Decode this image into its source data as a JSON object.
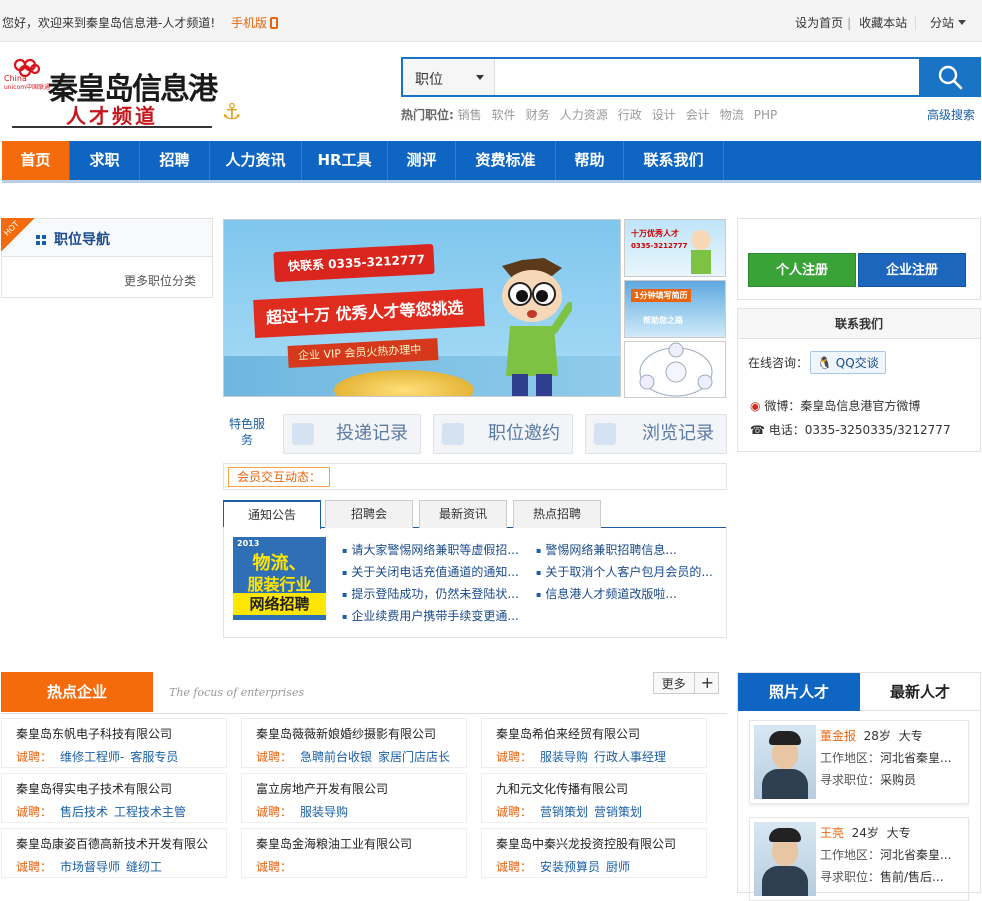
{
  "topbar": {
    "welcome": "您好，欢迎来到秦皇岛信息港-人才频道!",
    "mobile": "手机版",
    "set_home": "设为首页",
    "bookmark": "收藏本站",
    "substation": "分站"
  },
  "logo": {
    "text": "秦皇岛信息港",
    "sub": "人才频道",
    "unicom": "China unicom中国联通"
  },
  "search": {
    "category": "职位",
    "placeholder": "",
    "hot_label": "热门职位:",
    "hot": [
      "销售",
      "软件",
      "财务",
      "人力资源",
      "行政",
      "设计",
      "会计",
      "物流",
      "PHP"
    ],
    "advanced": "高级搜索"
  },
  "nav": [
    "首页",
    "求职",
    "招聘",
    "人力资讯",
    "HR工具",
    "测评",
    "资费标准",
    "帮助",
    "联系我们"
  ],
  "job_nav": {
    "hot": "HOT",
    "title": "职位导航",
    "more": "更多职位分类"
  },
  "banner": {
    "phone": "快联系 0335-3212777",
    "slogan": "超过十万 优秀人才等您挑选",
    "vip": "企业 VIP 会员火热办理中"
  },
  "services": {
    "label": "特色服务",
    "items": [
      "投递记录",
      "职位邀约",
      "浏览记录"
    ]
  },
  "dynamic": {
    "label": "会员交互动态："
  },
  "tabs": [
    "通知公告",
    "招聘会",
    "最新资讯",
    "热点招聘"
  ],
  "notice": {
    "image_text": [
      "2013",
      "物流、",
      "服装行业",
      "网络招聘"
    ],
    "left": [
      "请大家警惕网络兼职等虚假招...",
      "关于关闭电话充值通道的通知...",
      "提示登陆成功，仍然未登陆状...",
      "企业续费用户携带手续变更通..."
    ],
    "right": [
      "警惕网络兼职招聘信息...",
      "关于取消个人客户包月会员的...",
      "信息港人才频道改版啦..."
    ]
  },
  "register": {
    "personal": "个人注册",
    "company": "企业注册"
  },
  "contact": {
    "title": "联系我们",
    "online": "在线咨询：",
    "qq": "QQ交谈",
    "weibo": "微博：秦皇岛信息港官方微博",
    "phone": "电话：0335-3250335/3212777"
  },
  "hot_enterprises": {
    "title": "热点企业",
    "subtitle": "The focus of enterprises",
    "more": "更多",
    "label": "诚聘：",
    "items": [
      {
        "name": "秦皇岛东帆电子科技有限公司",
        "jobs": [
          "维修工程师-",
          "客服专员"
        ]
      },
      {
        "name": "秦皇岛薇薇新娘婚纱摄影有限公司",
        "jobs": [
          "急聘前台收银",
          "家居门店店长"
        ]
      },
      {
        "name": "秦皇岛希伯来经贸有限公司",
        "jobs": [
          "服装导购",
          "行政人事经理"
        ]
      },
      {
        "name": "秦皇岛得实电子技术有限公司",
        "jobs": [
          "售后技术",
          "工程技术主管"
        ]
      },
      {
        "name": "富立房地产开发有限公司",
        "jobs": [
          "服装导购"
        ]
      },
      {
        "name": "九和元文化传播有限公司",
        "jobs": [
          "营销策划",
          "营销策划"
        ]
      },
      {
        "name": "秦皇岛康姿百德高新技术开发有限公",
        "jobs": [
          "市场督导师",
          "缝纫工"
        ]
      },
      {
        "name": "秦皇岛金海粮油工业有限公司",
        "jobs": []
      },
      {
        "name": "秦皇岛中秦兴龙投资控股有限公司",
        "jobs": [
          "安装预算员",
          "厨师"
        ]
      }
    ]
  },
  "talent": {
    "tab_photo": "照片人才",
    "tab_new": "最新人才",
    "area_label": "工作地区：",
    "job_label": "寻求职位：",
    "people": [
      {
        "name": "董金报",
        "age": "28岁",
        "edu": "大专",
        "area": "河北省秦皇...",
        "job": "采购员"
      },
      {
        "name": "王亮",
        "age": "24岁",
        "edu": "大专",
        "area": "河北省秦皇...",
        "job": "售前/售后..."
      }
    ]
  }
}
